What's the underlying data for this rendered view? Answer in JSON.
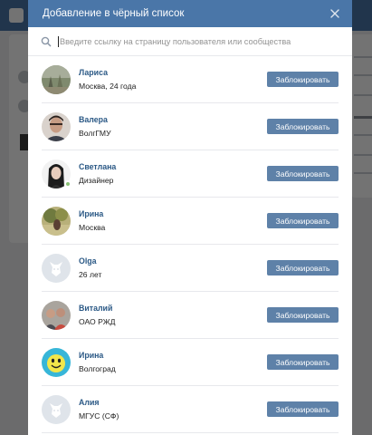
{
  "modal": {
    "title": "Добавление в чёрный список"
  },
  "search": {
    "placeholder": "Введите ссылку на страницу пользователя или сообщества",
    "value": ""
  },
  "colors": {
    "header": "#4a76a8",
    "button": "#5e81a8",
    "name_link": "#2a5885",
    "online": "#8ac176"
  },
  "users": [
    {
      "name": "Лариса",
      "subtitle": "Москва, 24 года",
      "button": "Заблокировать",
      "avatar": "photo-garden",
      "online": false
    },
    {
      "name": "Валера",
      "subtitle": "ВолгГМУ",
      "button": "Заблокировать",
      "avatar": "photo-man",
      "online": false
    },
    {
      "name": "Светлана",
      "subtitle": "Дизайнер",
      "button": "Заблокировать",
      "avatar": "photo-woman",
      "online": true
    },
    {
      "name": "Ирина",
      "subtitle": "Москва",
      "button": "Заблокировать",
      "avatar": "photo-tree",
      "online": false
    },
    {
      "name": "Olga",
      "subtitle": "26 лет",
      "button": "Заблокировать",
      "avatar": "default-dog",
      "online": false
    },
    {
      "name": "Виталий",
      "subtitle": "ОАО РЖД",
      "button": "Заблокировать",
      "avatar": "photo-group",
      "online": false
    },
    {
      "name": "Ирина",
      "subtitle": "Волгоград",
      "button": "Заблокировать",
      "avatar": "photo-smiley",
      "online": false
    },
    {
      "name": "Алия",
      "subtitle": "МГУС (СФ)",
      "button": "Заблокировать",
      "avatar": "default-dog",
      "online": false
    }
  ]
}
